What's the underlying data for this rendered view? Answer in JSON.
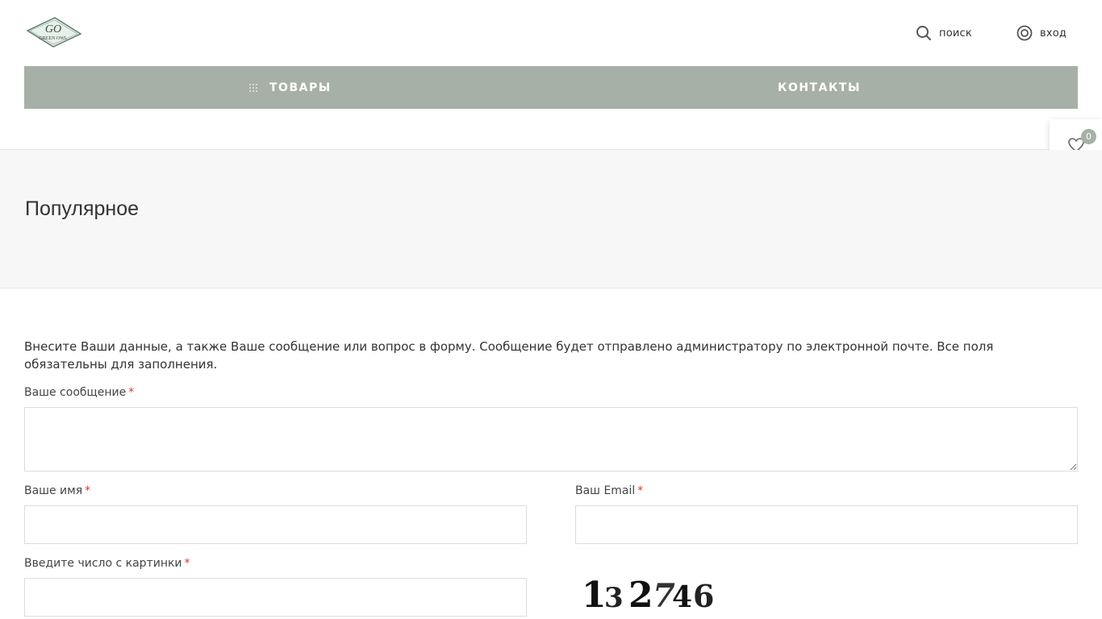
{
  "header": {
    "logo_text_top": "GO",
    "logo_text_bottom": "GREEN OWL",
    "search_label": "поиск",
    "login_label": "вход"
  },
  "nav": {
    "goods_label": "ТОВАРЫ",
    "contacts_label": "КОНТАКТЫ",
    "bg_color": "#a7b0a6"
  },
  "favorites": {
    "count": "0"
  },
  "popular": {
    "title": "Популярное"
  },
  "form": {
    "intro": "Внесите Ваши данные, а также Ваше сообщение или вопрос в форму. Сообщение будет отправлено администратору по электронной почте. Все поля обязательны для заполнения.",
    "message_label": "Ваше сообщение",
    "name_label": "Ваше имя",
    "email_label": "Ваш Email",
    "captcha_label": "Введите число с картинки",
    "required_mark": "*",
    "message_value": "",
    "name_value": "",
    "email_value": "",
    "captcha_value": "",
    "captcha_digits": "132746"
  }
}
